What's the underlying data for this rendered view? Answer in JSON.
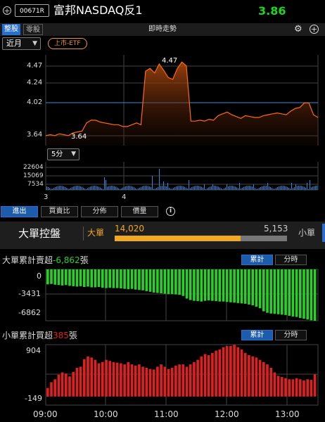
{
  "header": {
    "code": "00671R",
    "name": "富邦NASDAQ反1",
    "price": "3.86"
  },
  "subbar": {
    "tab_whole": "整股",
    "tab_odd": "零股",
    "title": "即時走勢"
  },
  "controls": {
    "period": "近月",
    "badge": "上市-ETF",
    "interval": "5分"
  },
  "price_chart": {
    "labels": [
      "4.47",
      "4.24",
      "4.02",
      "3.64"
    ],
    "high_marker": "4.47",
    "low_marker": "3.64",
    "volume_labels": [
      "22604",
      "15069",
      "7534"
    ],
    "day_labels": [
      "3",
      "4"
    ]
  },
  "tabs": [
    "進出",
    "買賣比",
    "分佈",
    "價量"
  ],
  "big_panel": {
    "title": "大單控盤",
    "left_tag": "大單",
    "big_value": "14,020",
    "small_value": "5,153",
    "right_tag": "小單",
    "ratio": 0.731
  },
  "big_section": {
    "title_prefix": "大單累計賣超",
    "title_value": "-6,862",
    "title_suffix": "張",
    "toggle_on": "累計",
    "toggle_off": "分時",
    "y_labels": [
      "0",
      "-3431",
      "-6862"
    ]
  },
  "small_section": {
    "title_prefix": "小單累計買超",
    "title_value": "385",
    "title_suffix": "張",
    "toggle_on": "累計",
    "toggle_off": "分時",
    "y_labels": [
      "904",
      "-149"
    ]
  },
  "time_axis": [
    "09:00",
    "10:00",
    "11:00",
    "12:00",
    "13:00"
  ],
  "colors": {
    "up": "#e02020",
    "down": "#28d028",
    "accent": "#f0a820",
    "line": "#ff6a10"
  },
  "chart_data": [
    {
      "type": "line",
      "title": "即時走勢",
      "ylim": [
        3.55,
        4.55
      ],
      "series": [
        {
          "values": [
            3.66,
            3.67,
            3.66,
            3.68,
            3.67,
            3.66,
            3.69,
            3.7,
            3.71,
            3.8,
            3.83,
            3.83,
            3.81,
            3.8,
            3.79,
            3.78,
            3.78,
            3.76,
            3.76,
            3.78,
            3.8,
            3.78,
            4.37,
            4.4,
            4.35,
            4.45,
            4.38,
            4.3,
            4.28,
            4.4,
            4.47,
            4.43,
            3.82,
            3.82,
            3.83,
            3.82,
            3.84,
            3.83,
            3.88,
            3.9,
            3.92,
            3.89,
            3.87,
            3.85,
            3.88,
            3.87,
            3.86,
            3.86,
            3.88,
            3.89,
            3.9,
            3.91,
            3.9,
            3.89,
            3.93,
            3.96,
            3.97,
            4.02,
            4.02,
            3.89,
            3.86
          ]
        }
      ]
    },
    {
      "type": "bar",
      "title": "大單累計賣超",
      "ylim": [
        -6862,
        0
      ],
      "values": [
        -2000,
        -1950,
        -2050,
        -2100,
        -2150,
        -2100,
        -2200,
        -2250,
        -2300,
        -2250,
        -2350,
        -2300,
        -2400,
        -2400,
        -2350,
        -2450,
        -2500,
        -2450,
        -2500,
        -2500,
        -2550,
        -2600,
        -2650,
        -2600,
        -2700,
        -2750,
        -2800,
        -2900,
        -3000,
        -3100,
        -3150,
        -3200,
        -3250,
        -3300,
        -3300,
        -3350,
        -3400,
        -3550,
        -3900,
        -4100,
        -4200,
        -4250,
        -4300,
        -4200,
        -4150,
        -4200,
        -4250,
        -4300,
        -4300,
        -4350,
        -4400,
        -4450,
        -4500,
        -4550,
        -4600,
        -4700,
        -4800,
        -5000,
        -5200,
        -5600,
        -5800,
        -5900,
        -5950,
        -6000,
        -6050,
        -6100,
        -6200,
        -6300,
        -6350,
        -6500,
        -6600,
        -6700,
        -6800,
        -6862
      ]
    },
    {
      "type": "bar",
      "title": "小單累計買超",
      "ylim": [
        -149,
        904
      ],
      "values": [
        150,
        250,
        300,
        380,
        420,
        400,
        350,
        430,
        500,
        520,
        650,
        700,
        680,
        640,
        580,
        600,
        640,
        620,
        600,
        590,
        580,
        560,
        600,
        560,
        540,
        560,
        520,
        500,
        480,
        470,
        520,
        560,
        520,
        480,
        500,
        540,
        560,
        560,
        520,
        560,
        600,
        640,
        700,
        740,
        720,
        760,
        800,
        820,
        860,
        880,
        880,
        904,
        860,
        820,
        760,
        720,
        700,
        680,
        640,
        600,
        560,
        500,
        420,
        360,
        340,
        320,
        300,
        300,
        320,
        300,
        280,
        300,
        290,
        385
      ]
    }
  ]
}
